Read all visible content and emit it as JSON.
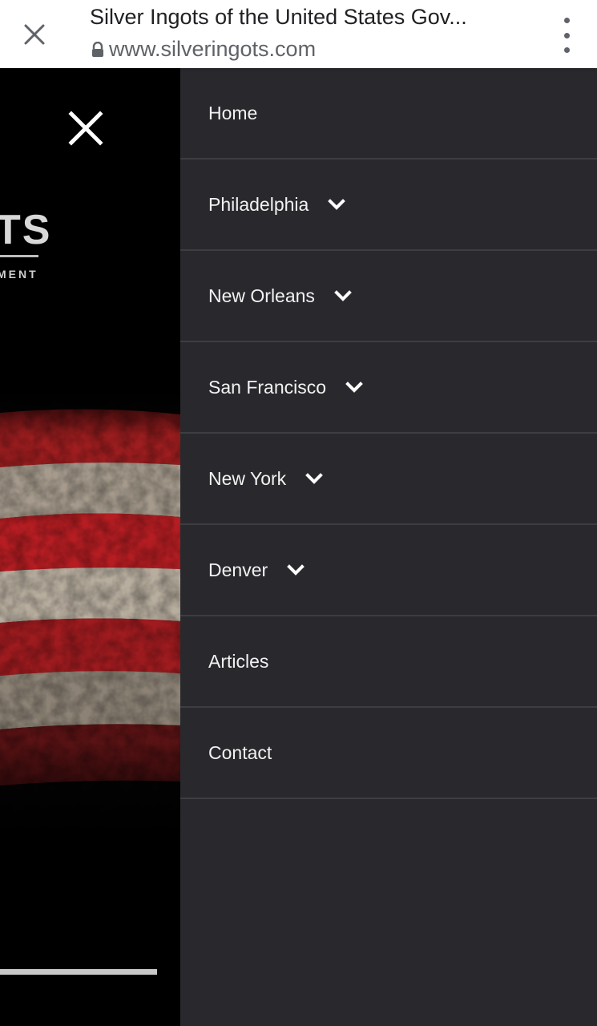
{
  "browser": {
    "title": "Silver Ingots of the United States Gov...",
    "url": "www.silveringots.com",
    "close_icon": "close-icon",
    "lock_icon": "lock-icon",
    "menu_icon": "more-vert-icon"
  },
  "site": {
    "logo_fragment": "TS",
    "logo_sub_fragment": "MENT",
    "close_icon": "close-icon"
  },
  "menu": {
    "items": [
      {
        "label": "Home",
        "has_dropdown": false
      },
      {
        "label": "Philadelphia",
        "has_dropdown": true
      },
      {
        "label": "New Orleans",
        "has_dropdown": true
      },
      {
        "label": "San Francisco",
        "has_dropdown": true
      },
      {
        "label": "New York",
        "has_dropdown": true
      },
      {
        "label": "Denver",
        "has_dropdown": true
      },
      {
        "label": "Articles",
        "has_dropdown": false
      },
      {
        "label": "Contact",
        "has_dropdown": false
      }
    ]
  },
  "colors": {
    "drawer_bg": "#29292d",
    "divider": "#3d3e42",
    "menu_text": "#f2f2f2"
  }
}
